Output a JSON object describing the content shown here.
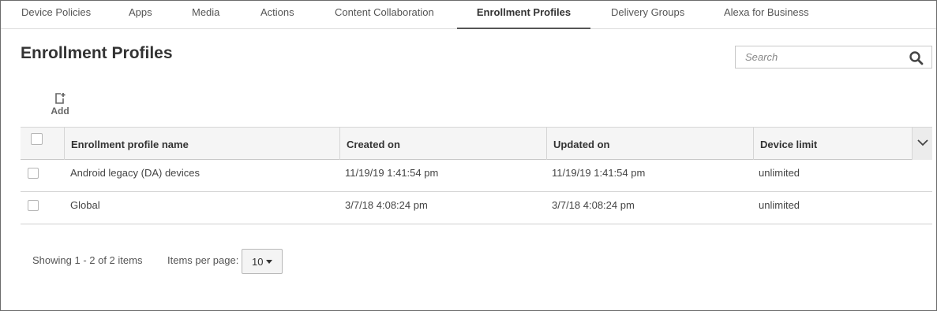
{
  "tabs": [
    {
      "label": "Device Policies"
    },
    {
      "label": "Apps"
    },
    {
      "label": "Media"
    },
    {
      "label": "Actions"
    },
    {
      "label": "Content Collaboration"
    },
    {
      "label": "Enrollment Profiles",
      "active": true
    },
    {
      "label": "Delivery Groups"
    },
    {
      "label": "Alexa for Business"
    }
  ],
  "page": {
    "title": "Enrollment Profiles"
  },
  "search": {
    "placeholder": "Search",
    "icon": "search-icon"
  },
  "toolbar": {
    "add_label": "Add",
    "add_icon": "add-document-icon"
  },
  "table": {
    "columns": [
      "Enrollment profile name",
      "Created on",
      "Updated on",
      "Device limit"
    ],
    "rows": [
      {
        "name": "Android legacy (DA) devices",
        "created": "11/19/19 1:41:54 pm",
        "updated": "11/19/19 1:41:54 pm",
        "limit": "unlimited"
      },
      {
        "name": "Global",
        "created": "3/7/18 4:08:24 pm",
        "updated": "3/7/18 4:08:24 pm",
        "limit": "unlimited"
      }
    ]
  },
  "footer": {
    "showing": "Showing 1 - 2 of 2 items",
    "per_page_label": "Items per page:",
    "per_page_value": "10"
  },
  "colors": {
    "text": "#333333",
    "border": "#6b6b6b",
    "header_bg": "#f5f5f5"
  }
}
